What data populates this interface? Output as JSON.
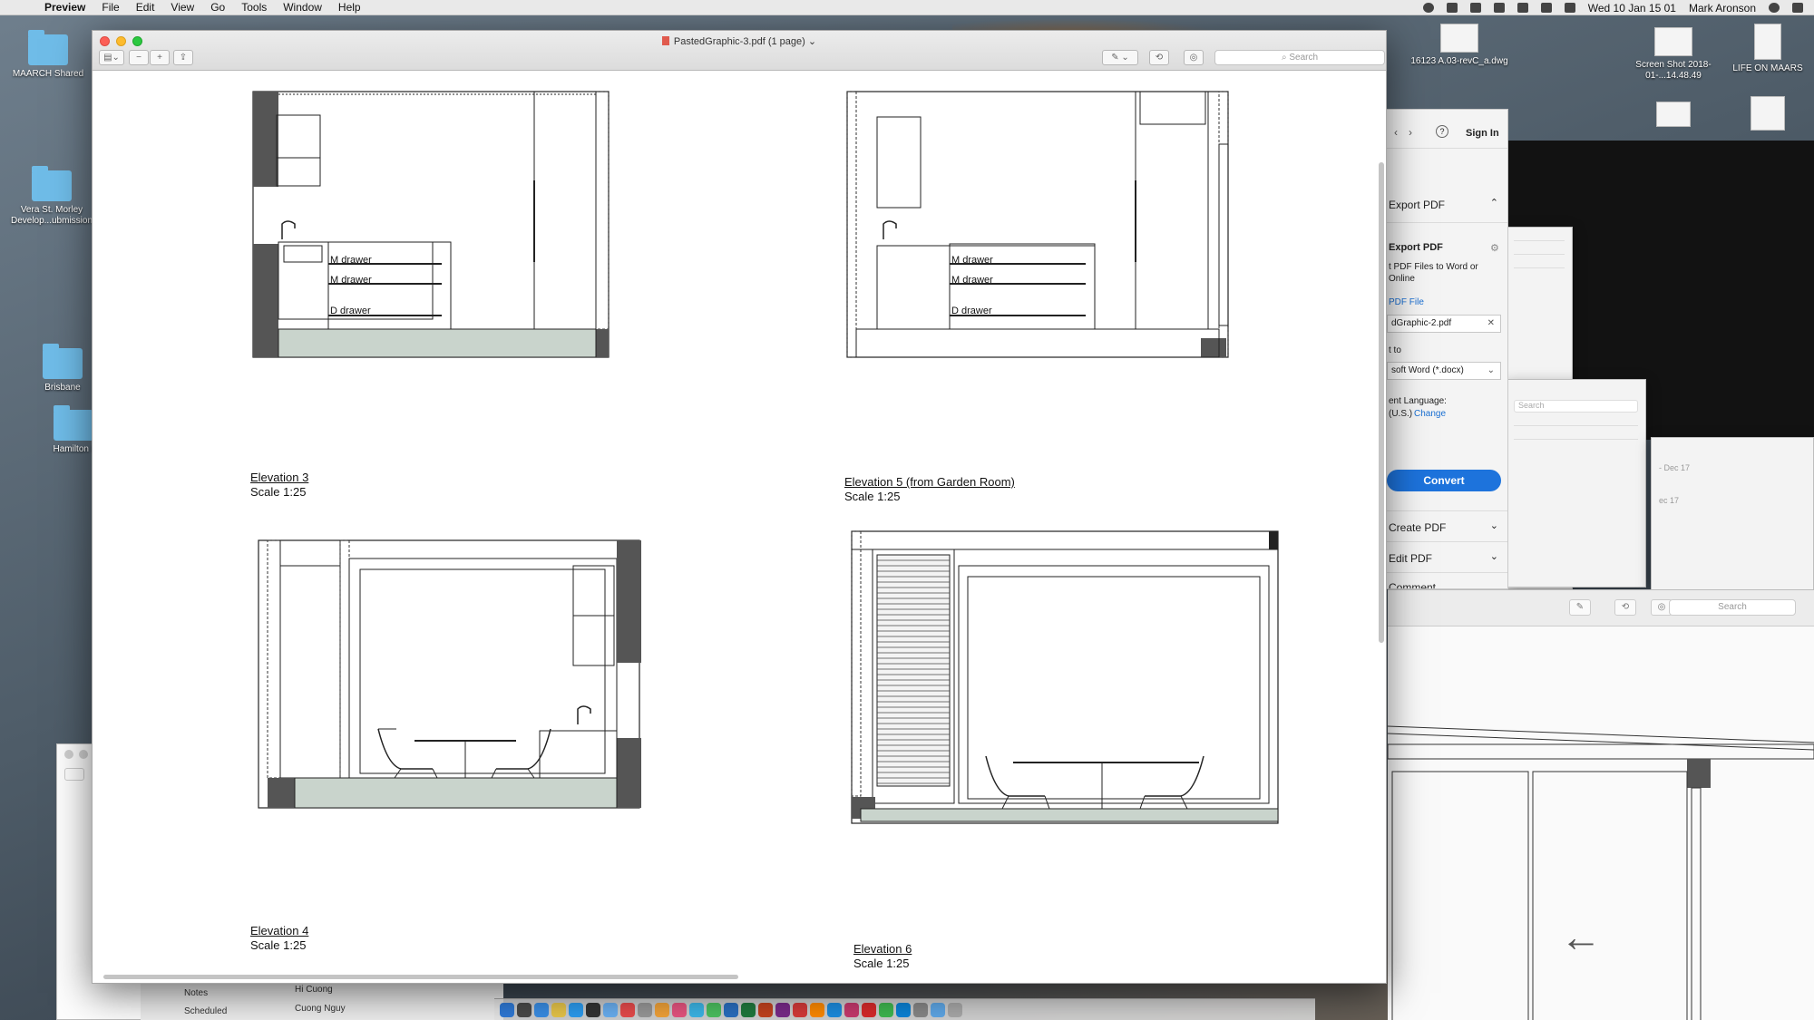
{
  "menubar": {
    "app_name": "Preview",
    "items": [
      "File",
      "Edit",
      "View",
      "Go",
      "Tools",
      "Window",
      "Help"
    ],
    "clock": "Wed 10 Jan  15 01",
    "user": "Mark Aronson"
  },
  "desktop": {
    "icons": [
      {
        "label": "MAARCH Shared"
      },
      {
        "label": "Vera St. Morley Develop...ubmission"
      },
      {
        "label": "Brisbane"
      },
      {
        "label": "Hamilton I"
      },
      {
        "label": "16123 A.03-revC_a.dwg"
      },
      {
        "label": "Screen Shot 2018-01-...14.48.49"
      },
      {
        "label": "LIFE ON MAARS"
      }
    ]
  },
  "window": {
    "title": "PastedGraphic-3.pdf (1 page)",
    "search_placeholder": "Search"
  },
  "document": {
    "elevations": [
      {
        "name": "Elevation 3",
        "scale": "Scale 1:25",
        "labels": [
          "M drawer",
          "M drawer",
          "D drawer"
        ]
      },
      {
        "name": "Elevation 5 (from Garden Room)",
        "scale": "Scale 1:25",
        "labels": [
          "M drawer",
          "M drawer",
          "D drawer"
        ]
      },
      {
        "name": "Elevation 4",
        "scale": "Scale 1:25"
      },
      {
        "name": "Elevation 6",
        "scale": "Scale 1:25"
      }
    ]
  },
  "acrobat": {
    "sign_in": "Sign In",
    "export_pdf": "Export PDF",
    "export_pdf_sub": "Export PDF",
    "export_desc_1": "t PDF Files to Word or",
    "export_desc_2": "Online",
    "pdf_file": "PDF File",
    "file_name": "dGraphic-2.pdf",
    "convert_to": "t to",
    "format": "soft Word (*.docx)",
    "language_label": "ent Language:",
    "language_value": "(U.S.)",
    "change": "Change",
    "convert_button": "Convert",
    "create_pdf": "Create PDF",
    "edit_pdf": "Edit PDF",
    "comment": "Comment"
  },
  "background": {
    "search_placeholder": "Search",
    "dec_1": "- Dec 17",
    "dec_2": "ec 17"
  },
  "mail": {
    "items": [
      "Notes",
      "Scheduled"
    ],
    "names": [
      "Hi Cuong",
      "Cuong Nguy"
    ]
  }
}
